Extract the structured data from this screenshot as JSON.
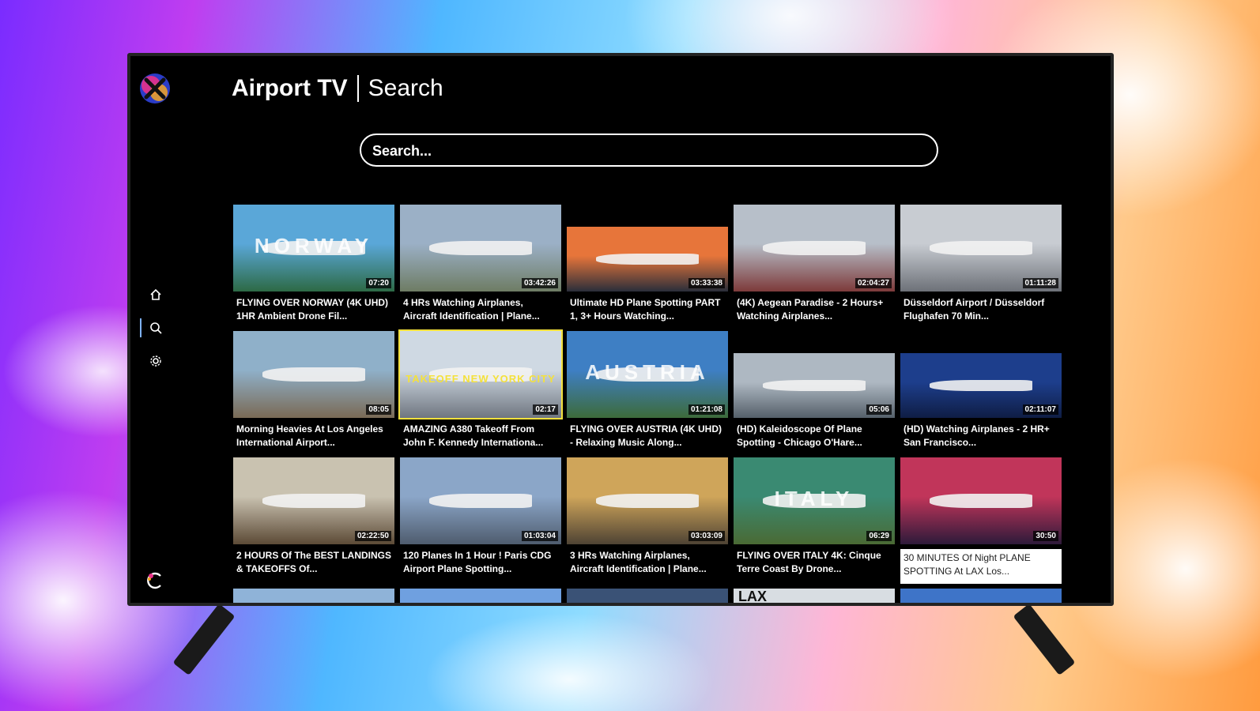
{
  "header": {
    "app_title": "Airport TV",
    "page_title": "Search"
  },
  "search": {
    "placeholder": "Search..."
  },
  "nav": {
    "items": [
      {
        "icon": "home-icon"
      },
      {
        "icon": "search-icon",
        "active": true
      },
      {
        "icon": "gear-icon"
      }
    ]
  },
  "videos": [
    [
      {
        "title": "FLYING OVER NORWAY (4K UHD) 1HR Ambient Drone Fil...",
        "duration": "07:20",
        "overlay": "NORWAY",
        "colors": [
          "#5aa7d8",
          "#2d6a45"
        ]
      },
      {
        "title": "4 HRs Watching Airplanes, Aircraft Identification | Plane...",
        "duration": "03:42:26",
        "colors": [
          "#9bb0c6",
          "#6e7c64"
        ]
      },
      {
        "title": "Ultimate HD Plane Spotting PART 1, 3+ Hours Watching...",
        "duration": "03:33:38",
        "short": true,
        "colors": [
          "#e7753a",
          "#2a2e3a"
        ]
      },
      {
        "title": "(4K) Aegean Paradise - 2 Hours+ Watching Airplanes...",
        "duration": "02:04:27",
        "colors": [
          "#b7bfc9",
          "#7d3a3a"
        ]
      },
      {
        "title": "Düsseldorf Airport / Düsseldorf Flughafen 70 Min...",
        "duration": "01:11:28",
        "colors": [
          "#c8ccd2",
          "#6d7178"
        ]
      }
    ],
    [
      {
        "title": "Morning Heavies At Los Angeles International Airport...",
        "duration": "08:05",
        "colors": [
          "#8fb0c9",
          "#7a6a55"
        ]
      },
      {
        "title": "AMAZING A380 Takeoff From John F. Kennedy Internationa...",
        "duration": "02:17",
        "overlay": "TAKEOFF NEW YORK CITY",
        "focused": true,
        "colors": [
          "#cfd9e3",
          "#6f7680"
        ]
      },
      {
        "title": "FLYING OVER AUSTRIA (4K UHD) - Relaxing Music Along...",
        "duration": "01:21:08",
        "overlay": "AUSTRIA",
        "colors": [
          "#3e7fc4",
          "#3d6b3a"
        ]
      },
      {
        "title": "(HD) Kaleidoscope Of Plane Spotting - Chicago O'Hare...",
        "duration": "05:06",
        "short": true,
        "colors": [
          "#aeb8c2",
          "#55606a"
        ]
      },
      {
        "title": "(HD) Watching Airplanes - 2 HR+ San Francisco...",
        "duration": "02:11:07",
        "short": true,
        "colors": [
          "#1d3e8c",
          "#0f1d44"
        ]
      }
    ],
    [
      {
        "title": "2 HOURS Of The BEST LANDINGS & TAKEOFFS Of...",
        "duration": "02:22:50",
        "colors": [
          "#c9c2b0",
          "#5c4a36"
        ]
      },
      {
        "title": "120 Planes In 1 Hour ! Paris CDG Airport Plane Spotting...",
        "duration": "01:03:04",
        "colors": [
          "#8ba6c8",
          "#4f5c6e"
        ]
      },
      {
        "title": "3 HRs Watching Airplanes, Aircraft Identification | Plane...",
        "duration": "03:03:09",
        "colors": [
          "#cfa55a",
          "#4e4334"
        ]
      },
      {
        "title": "FLYING OVER ITALY 4K: Cinque Terre Coast By Drone...",
        "duration": "06:29",
        "overlay": "ITALY",
        "colors": [
          "#3a8a72",
          "#4a6a34"
        ]
      },
      {
        "title": "30 MINUTES Of Night PLANE SPOTTING At LAX Los...",
        "duration": "30:50",
        "light": true,
        "colors": [
          "#c1355a",
          "#2d1a3a"
        ]
      }
    ]
  ],
  "peek_row": {
    "labels": [
      "",
      "",
      "",
      "LAX",
      ""
    ],
    "colors": [
      "#8fb3d8",
      "#6fa0e0",
      "#3a5276",
      "#d8dde2",
      "#3e74c8"
    ]
  }
}
